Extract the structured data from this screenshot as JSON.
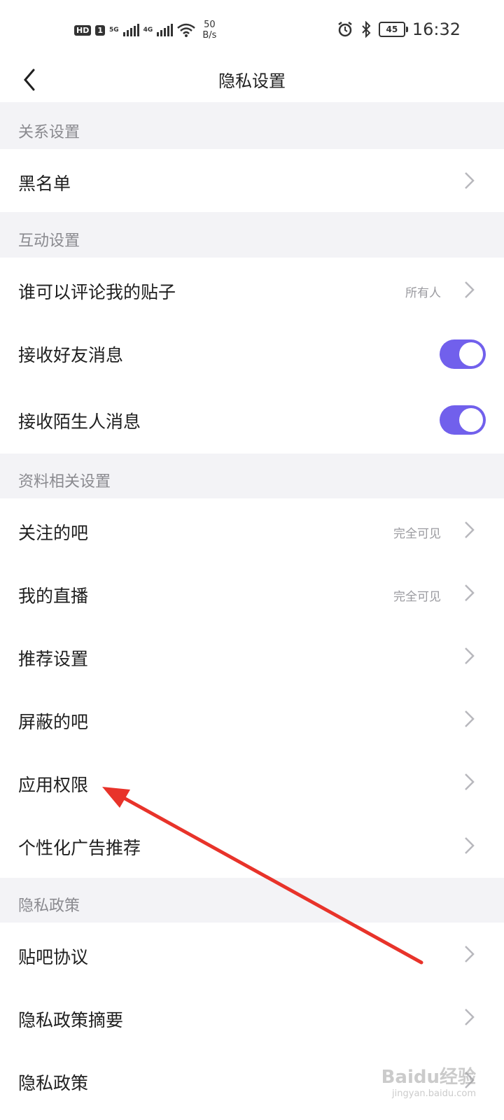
{
  "status_bar": {
    "hd_label": "HD",
    "sim_label": "1",
    "net1": "5G",
    "net2": "4G",
    "speed_value": "50",
    "speed_unit": "B/s",
    "battery": "45",
    "time": "16:32"
  },
  "navbar": {
    "back_icon": "chevron-left-icon",
    "title": "隐私设置"
  },
  "sections": {
    "relationship": {
      "header": "关系设置",
      "items": [
        {
          "label": "黑名单"
        }
      ]
    },
    "interaction": {
      "header": "互动设置",
      "items": [
        {
          "label": "谁可以评论我的贴子",
          "value": "所有人"
        },
        {
          "label": "接收好友消息",
          "toggle": true
        },
        {
          "label": "接收陌生人消息",
          "toggle": true
        }
      ]
    },
    "profile": {
      "header": "资料相关设置",
      "items": [
        {
          "label": "关注的吧",
          "value": "完全可见"
        },
        {
          "label": "我的直播",
          "value": "完全可见"
        },
        {
          "label": "推荐设置"
        },
        {
          "label": "屏蔽的吧"
        },
        {
          "label": "应用权限"
        },
        {
          "label": "个性化广告推荐"
        }
      ]
    },
    "policy": {
      "header": "隐私政策",
      "items": [
        {
          "label": "贴吧协议"
        },
        {
          "label": "隐私政策摘要"
        },
        {
          "label": "隐私政策"
        }
      ]
    }
  },
  "colors": {
    "accent": "#7160ec",
    "annotation_arrow": "#e8332a",
    "background": "#f3f3f6"
  },
  "watermark": {
    "main": "Baidu经验",
    "sub": "jingyan.baidu.com"
  }
}
